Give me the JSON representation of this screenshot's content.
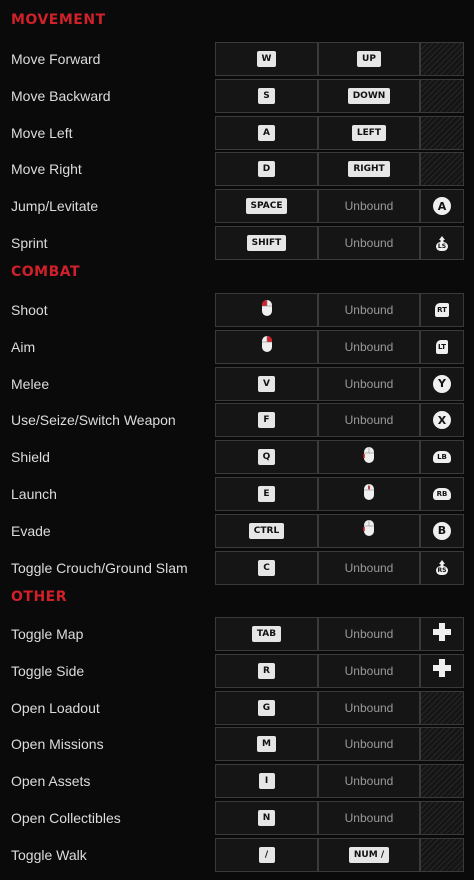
{
  "sections": [
    {
      "title": "MOVEMENT",
      "rows": [
        {
          "action": "Move Forward",
          "primary": "W",
          "secondary": "UP",
          "pad": ""
        },
        {
          "action": "Move Backward",
          "primary": "S",
          "secondary": "DOWN",
          "pad": ""
        },
        {
          "action": "Move Left",
          "primary": "A",
          "secondary": "LEFT",
          "pad": ""
        },
        {
          "action": "Move Right",
          "primary": "D",
          "secondary": "RIGHT",
          "pad": ""
        },
        {
          "action": "Jump/Levitate",
          "primary": "SPACE",
          "secondary": "Unbound",
          "pad": "A"
        },
        {
          "action": "Sprint",
          "primary": "SHIFT",
          "secondary": "Unbound",
          "pad": "LS"
        }
      ]
    },
    {
      "title": "COMBAT",
      "rows": [
        {
          "action": "Shoot",
          "primary": "mouse-left",
          "secondary": "Unbound",
          "pad": "RT"
        },
        {
          "action": "Aim",
          "primary": "mouse-right",
          "secondary": "Unbound",
          "pad": "LT"
        },
        {
          "action": "Melee",
          "primary": "V",
          "secondary": "Unbound",
          "pad": "Y"
        },
        {
          "action": "Use/Seize/Switch Weapon",
          "primary": "F",
          "secondary": "Unbound",
          "pad": "X"
        },
        {
          "action": "Shield",
          "primary": "Q",
          "secondary": "mouse-side",
          "pad": "LB"
        },
        {
          "action": "Launch",
          "primary": "E",
          "secondary": "mouse-middle",
          "pad": "RB"
        },
        {
          "action": "Evade",
          "primary": "CTRL",
          "secondary": "mouse-side",
          "pad": "B"
        },
        {
          "action": "Toggle Crouch/Ground Slam",
          "primary": "C",
          "secondary": "Unbound",
          "pad": "RS"
        }
      ]
    },
    {
      "title": "OTHER",
      "rows": [
        {
          "action": "Toggle Map",
          "primary": "TAB",
          "secondary": "Unbound",
          "pad": "dpad"
        },
        {
          "action": "Toggle Side",
          "primary": "R",
          "secondary": "Unbound",
          "pad": "dpad"
        },
        {
          "action": "Open Loadout",
          "primary": "G",
          "secondary": "Unbound",
          "pad": ""
        },
        {
          "action": "Open Missions",
          "primary": "M",
          "secondary": "Unbound",
          "pad": ""
        },
        {
          "action": "Open Assets",
          "primary": "I",
          "secondary": "Unbound",
          "pad": ""
        },
        {
          "action": "Open Collectibles",
          "primary": "N",
          "secondary": "Unbound",
          "pad": ""
        },
        {
          "action": "Toggle Walk",
          "primary": "/",
          "secondary": "NUM /",
          "pad": ""
        }
      ]
    }
  ],
  "colors": {
    "section_title": "#d0202a",
    "key_bg": "#e6e6e6",
    "cell_bg": "#151515",
    "mouse_highlight": "#d0202a"
  }
}
